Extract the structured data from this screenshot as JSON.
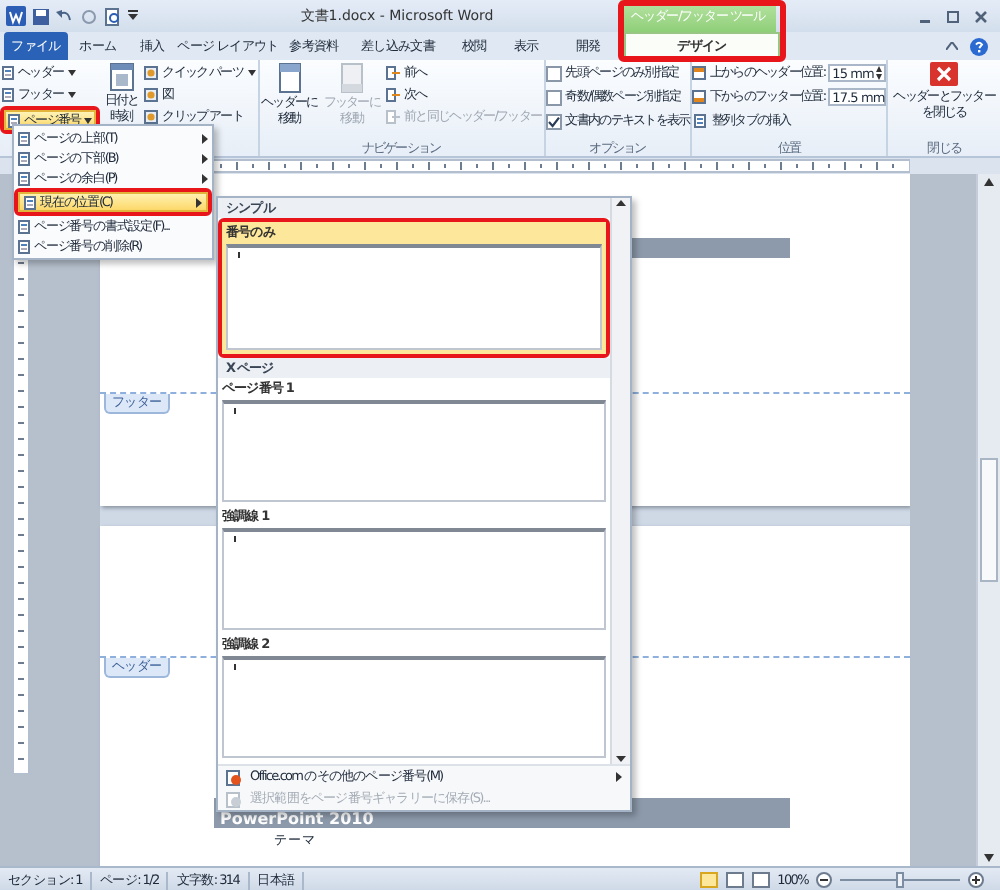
{
  "title_bar": {
    "title": "文書1.docx - Microsoft Word",
    "context_label": "ヘッダー/フッター ツール",
    "context_highlighted": true
  },
  "tabs": [
    {
      "label": "ファイル",
      "kind": "file",
      "selected": false
    },
    {
      "label": "ホーム",
      "kind": "normal",
      "selected": false
    },
    {
      "label": "挿入",
      "kind": "normal",
      "selected": false
    },
    {
      "label": "ページ レイアウト",
      "kind": "normal",
      "selected": false
    },
    {
      "label": "参考資料",
      "kind": "normal",
      "selected": false
    },
    {
      "label": "差し込み文書",
      "kind": "normal",
      "selected": false
    },
    {
      "label": "校閲",
      "kind": "normal",
      "selected": false
    },
    {
      "label": "表示",
      "kind": "normal",
      "selected": false
    },
    {
      "label": "開発",
      "kind": "normal",
      "selected": false
    },
    {
      "label": "デザイン",
      "kind": "context",
      "selected": true
    }
  ],
  "ribbon": {
    "header_footer": [
      {
        "label": "ヘッダー",
        "selected": false,
        "highlighted": false
      },
      {
        "label": "フッター",
        "selected": false,
        "highlighted": false
      },
      {
        "label": "ページ番号",
        "selected": true,
        "highlighted": true
      }
    ],
    "date_time": [
      "日付と",
      "時刻"
    ],
    "insert": [
      {
        "label": "クイック パーツ",
        "menu": true
      },
      {
        "label": "図",
        "menu": false
      },
      {
        "label": "クリップ アート",
        "menu": false
      }
    ],
    "navigation": {
      "label": "ナビゲーション",
      "large": [
        {
          "lines": [
            "ヘッダーに",
            "移動"
          ],
          "disabled": false
        },
        {
          "lines": [
            "フッターに",
            "移動"
          ],
          "disabled": true
        }
      ],
      "small": [
        {
          "label": "前へ",
          "disabled": false
        },
        {
          "label": "次へ",
          "disabled": false
        },
        {
          "label": "前と同じヘッダー/フッター",
          "disabled": true
        }
      ]
    },
    "options": {
      "label": "オプション",
      "checks": [
        {
          "label": "先頭ページのみ別指定",
          "checked": false
        },
        {
          "label": "奇数/偶数ページ別指定",
          "checked": false
        },
        {
          "label": "文書内のテキストを表示",
          "checked": true
        }
      ]
    },
    "position": {
      "label": "位置",
      "fields": [
        {
          "label": "上からのヘッダー位置:",
          "value": "15 mm"
        },
        {
          "label": "下からのフッター位置:",
          "value": "17.5 mm"
        }
      ],
      "action": "整列タブの挿入"
    },
    "close": {
      "label": "閉じる",
      "lines": [
        "ヘッダーとフッター",
        "を閉じる"
      ]
    }
  },
  "document": {
    "footer_tag": "フッター",
    "header_tag": "ヘッダー",
    "heading": "PowerPoint 2010",
    "body": "テーマ"
  },
  "page_number_menu": [
    {
      "label": "ページの上部(T)",
      "submenu": true,
      "selected": false,
      "highlighted": false
    },
    {
      "label": "ページの下部(B)",
      "submenu": true,
      "selected": false,
      "highlighted": false
    },
    {
      "label": "ページの余白(P)",
      "submenu": true,
      "selected": false,
      "highlighted": false
    },
    {
      "label": "現在の位置(C)",
      "submenu": true,
      "selected": true,
      "highlighted": true
    },
    {
      "label": "ページ番号の書式設定(F)...",
      "submenu": false,
      "selected": false,
      "highlighted": false
    },
    {
      "label": "ページ番号の削除(R)",
      "submenu": false,
      "selected": false,
      "highlighted": false
    }
  ],
  "gallery": {
    "sections": [
      {
        "heading": "シンプル",
        "items": [
          {
            "label": "番号のみ",
            "selected": true,
            "highlighted": true
          }
        ]
      },
      {
        "heading": "X ページ",
        "items": [
          {
            "label": "ページ番号 1",
            "selected": false,
            "highlighted": false
          },
          {
            "label": "強調線 1",
            "selected": false,
            "highlighted": false
          },
          {
            "label": "強調線 2",
            "selected": false,
            "highlighted": false
          }
        ]
      }
    ],
    "actions": [
      {
        "label": "Office.com のその他のページ番号(M)",
        "submenu": true,
        "disabled": false
      },
      {
        "label": "選択範囲をページ番号ギャラリーに保存(S)...",
        "submenu": false,
        "disabled": true
      }
    ]
  },
  "status_bar": {
    "items": [
      "セクション: 1",
      "ページ: 1/2",
      "文字数: 314",
      "日本語"
    ],
    "zoom": "100%",
    "zoom_slider": {
      "level": 0.5
    }
  }
}
